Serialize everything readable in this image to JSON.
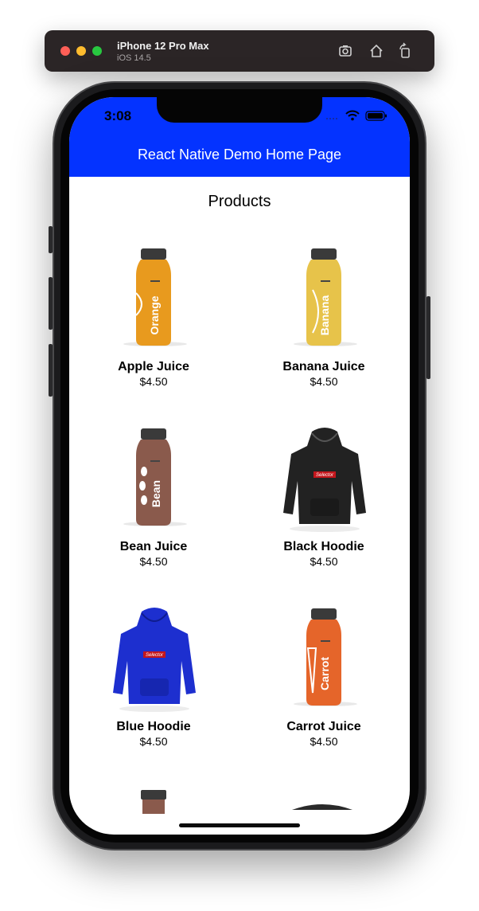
{
  "simulator": {
    "device_name": "iPhone 12 Pro Max",
    "os_version": "iOS 14.5",
    "icons": [
      "screenshot-icon",
      "home-icon",
      "rotate-icon"
    ]
  },
  "status_bar": {
    "time": "3:08"
  },
  "header": {
    "title": "React Native Demo Home Page",
    "background": "#0433ff"
  },
  "main": {
    "section_title": "Products",
    "products": [
      {
        "name": "Apple Juice",
        "price": "$4.50",
        "image": "orange-juice-bottle",
        "label": "Orange",
        "color": "#e89a1e"
      },
      {
        "name": "Banana Juice",
        "price": "$4.50",
        "image": "banana-juice-bottle",
        "label": "Banana",
        "color": "#e7c34a"
      },
      {
        "name": "Bean Juice",
        "price": "$4.50",
        "image": "bean-juice-bottle",
        "label": "Bean",
        "color": "#8a5a4c"
      },
      {
        "name": "Black Hoodie",
        "price": "$4.50",
        "image": "black-hoodie",
        "label": "Selector",
        "color": "#222222"
      },
      {
        "name": "Blue Hoodie",
        "price": "$4.50",
        "image": "blue-hoodie",
        "label": "Selector",
        "color": "#1d2fcf"
      },
      {
        "name": "Carrot Juice",
        "price": "$4.50",
        "image": "carrot-juice-bottle",
        "label": "Carrot",
        "color": "#e5652a"
      }
    ]
  }
}
